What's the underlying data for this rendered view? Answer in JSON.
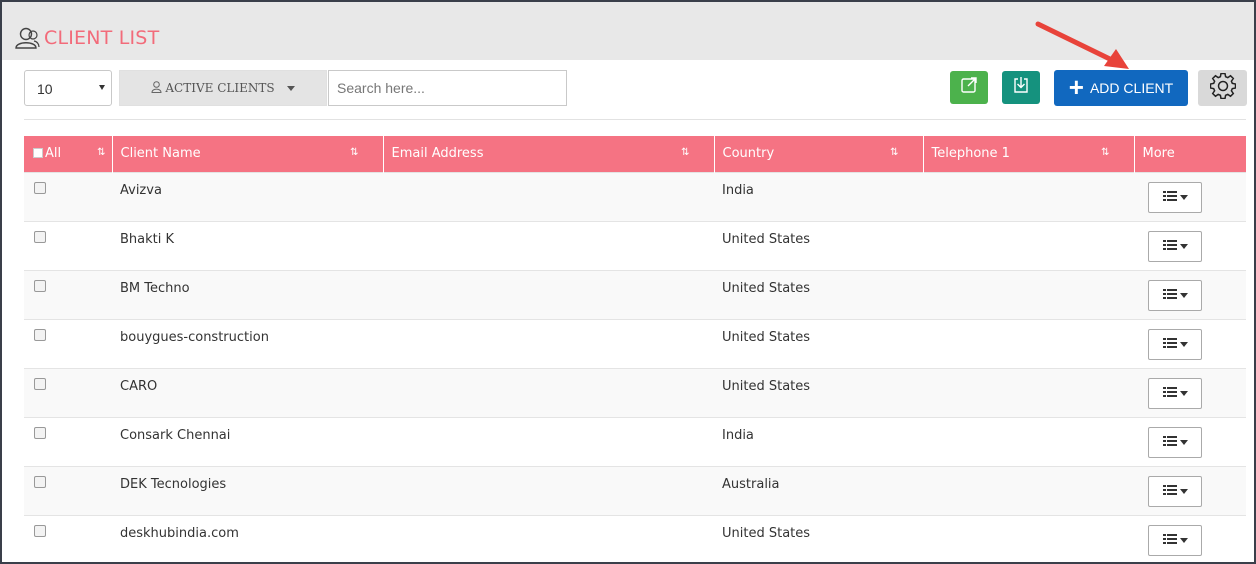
{
  "page": {
    "title": "CLIENT LIST"
  },
  "toolbar": {
    "page_size": "10",
    "filter_label": "ACTIVE CLIENTS",
    "search_placeholder": "Search here...",
    "add_label": "ADD CLIENT"
  },
  "table": {
    "headers": {
      "all": "All",
      "client_name": "Client Name",
      "email": "Email Address",
      "country": "Country",
      "telephone": "Telephone 1",
      "more": "More"
    },
    "rows": [
      {
        "name": "Avizva",
        "email": "",
        "country": "India",
        "telephone": ""
      },
      {
        "name": "Bhakti K",
        "email": "",
        "country": "United States",
        "telephone": ""
      },
      {
        "name": "BM Techno",
        "email": "",
        "country": "United States",
        "telephone": ""
      },
      {
        "name": "bouygues-construction",
        "email": "",
        "country": "United States",
        "telephone": ""
      },
      {
        "name": "CARO",
        "email": "",
        "country": "United States",
        "telephone": ""
      },
      {
        "name": "Consark Chennai",
        "email": "",
        "country": "India",
        "telephone": ""
      },
      {
        "name": "DEK Tecnologies",
        "email": "",
        "country": "Australia",
        "telephone": ""
      },
      {
        "name": "deskhubindia.com",
        "email": "",
        "country": "United States",
        "telephone": ""
      }
    ]
  },
  "colors": {
    "accent": "#f57383",
    "title": "#f26b7a",
    "add_button": "#1168bf",
    "export_button": "#4cb24c",
    "import_button": "#15927e",
    "annotation_arrow": "#e8433a"
  },
  "icons": {
    "title": "users-icon",
    "export": "export-icon",
    "import": "import-icon",
    "add": "plus-icon",
    "settings": "gear-icon",
    "more": "list-icon"
  }
}
